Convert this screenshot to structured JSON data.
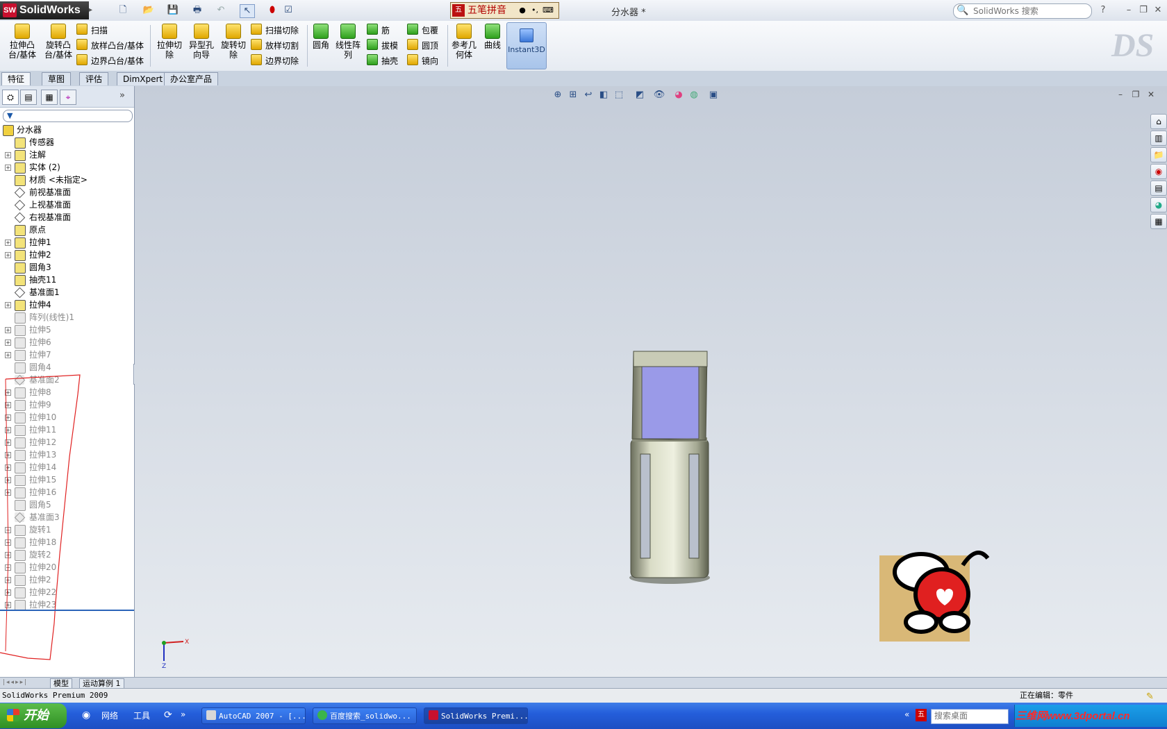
{
  "app": {
    "name": "SolidWorks",
    "document_title": "分水器 *"
  },
  "ime": {
    "label": "五笔拼音"
  },
  "search": {
    "placeholder": "SolidWorks 搜索"
  },
  "ribbon": {
    "extrude_boss": "拉伸凸台/基体",
    "revolve_boss": "旋转凸台/基体",
    "sweep": "扫描",
    "loft": "放样凸台/基体",
    "boundary_boss": "边界凸台/基体",
    "extrude_cut": "拉伸切除",
    "hole_wizard": "异型孔向导",
    "revolve_cut": "旋转切除",
    "swept_cut": "扫描切除",
    "lofted_cut": "放样切割",
    "boundary_cut": "边界切除",
    "fillet": "圆角",
    "linear_pattern": "线性阵列",
    "rib": "筋",
    "draft": "拔模",
    "shell": "抽壳",
    "wrap": "包覆",
    "dome": "圆顶",
    "mirror": "镜向",
    "ref_geometry": "参考几何体",
    "curves": "曲线",
    "instant3d": "Instant3D"
  },
  "tabs": [
    "特征",
    "草图",
    "评估",
    "DimXpert",
    "办公室产品"
  ],
  "tree": {
    "root": "分水器",
    "items": [
      {
        "label": "传感器",
        "expand": false,
        "sup": false,
        "icon": "sensor-icon"
      },
      {
        "label": "注解",
        "expand": true,
        "sup": false,
        "icon": "annotation-icon"
      },
      {
        "label": "实体 (2)",
        "expand": true,
        "sup": false,
        "icon": "solid-bodies-icon"
      },
      {
        "label": "材质 <未指定>",
        "expand": false,
        "sup": false,
        "icon": "material-icon"
      },
      {
        "label": "前视基准面",
        "expand": false,
        "sup": false,
        "icon": "plane-icon"
      },
      {
        "label": "上视基准面",
        "expand": false,
        "sup": false,
        "icon": "plane-icon"
      },
      {
        "label": "右视基准面",
        "expand": false,
        "sup": false,
        "icon": "plane-icon"
      },
      {
        "label": "原点",
        "expand": false,
        "sup": false,
        "icon": "origin-icon"
      },
      {
        "label": "拉伸1",
        "expand": true,
        "sup": false,
        "icon": "extrude-icon"
      },
      {
        "label": "拉伸2",
        "expand": true,
        "sup": false,
        "icon": "extrude-icon"
      },
      {
        "label": "圆角3",
        "expand": false,
        "sup": false,
        "icon": "fillet-icon"
      },
      {
        "label": "抽壳11",
        "expand": false,
        "sup": false,
        "icon": "shell-icon"
      },
      {
        "label": "基准面1",
        "expand": false,
        "sup": false,
        "icon": "plane-icon"
      },
      {
        "label": "拉伸4",
        "expand": true,
        "sup": false,
        "icon": "extrude-icon"
      },
      {
        "label": "阵列(线性)1",
        "expand": false,
        "sup": true,
        "icon": "pattern-icon"
      },
      {
        "label": "拉伸5",
        "expand": true,
        "sup": true,
        "icon": "extrude-icon"
      },
      {
        "label": "拉伸6",
        "expand": true,
        "sup": true,
        "icon": "extrude-icon"
      },
      {
        "label": "拉伸7",
        "expand": true,
        "sup": true,
        "icon": "extrude-icon"
      },
      {
        "label": "圆角4",
        "expand": false,
        "sup": true,
        "icon": "fillet-icon"
      },
      {
        "label": "基准面2",
        "expand": false,
        "sup": true,
        "icon": "plane-icon"
      },
      {
        "label": "拉伸8",
        "expand": true,
        "sup": true,
        "icon": "extrude-icon"
      },
      {
        "label": "拉伸9",
        "expand": true,
        "sup": true,
        "icon": "extrude-icon"
      },
      {
        "label": "拉伸10",
        "expand": true,
        "sup": true,
        "icon": "extrude-icon"
      },
      {
        "label": "拉伸11",
        "expand": true,
        "sup": true,
        "icon": "extrude-icon"
      },
      {
        "label": "拉伸12",
        "expand": true,
        "sup": true,
        "icon": "extrude-icon"
      },
      {
        "label": "拉伸13",
        "expand": true,
        "sup": true,
        "icon": "extrude-icon"
      },
      {
        "label": "拉伸14",
        "expand": true,
        "sup": true,
        "icon": "extrude-icon"
      },
      {
        "label": "拉伸15",
        "expand": true,
        "sup": true,
        "icon": "extrude-icon"
      },
      {
        "label": "拉伸16",
        "expand": true,
        "sup": true,
        "icon": "extrude-icon"
      },
      {
        "label": "圆角5",
        "expand": false,
        "sup": true,
        "icon": "fillet-icon"
      },
      {
        "label": "基准面3",
        "expand": false,
        "sup": true,
        "icon": "plane-icon"
      },
      {
        "label": "旋转1",
        "expand": true,
        "sup": true,
        "icon": "revolve-icon"
      },
      {
        "label": "拉伸18",
        "expand": true,
        "sup": true,
        "icon": "extrude-icon"
      },
      {
        "label": "旋转2",
        "expand": true,
        "sup": true,
        "icon": "revolve-icon"
      },
      {
        "label": "拉伸20",
        "expand": true,
        "sup": true,
        "icon": "extrude-icon"
      },
      {
        "label": "拉伸2",
        "expand": true,
        "sup": true,
        "icon": "extrude-icon"
      },
      {
        "label": "拉伸22",
        "expand": true,
        "sup": true,
        "icon": "extrude-icon"
      },
      {
        "label": "拉伸23",
        "expand": true,
        "sup": true,
        "icon": "extrude-icon"
      }
    ]
  },
  "bottom_tabs": [
    "模型",
    "运动算例 1"
  ],
  "status": {
    "product": "SolidWorks Premium 2009",
    "editing": "正在编辑：零件"
  },
  "triad": {
    "x_label": "X",
    "z_label": "Z"
  },
  "taskbar": {
    "start": "开始",
    "items": [
      "网络",
      "工具"
    ],
    "tasks": [
      "AutoCAD 2007 - [...",
      "百度搜索_solidwo...",
      "SolidWorks Premi..."
    ],
    "search_placeholder": "搜索桌面",
    "watermark": "三维网www.3dportal.cn"
  },
  "colors": {
    "accent": "#245edb",
    "suppressed_text": "#8a8a8a",
    "model_face": "#9a9ae8",
    "annotation_red": "#e02020"
  }
}
